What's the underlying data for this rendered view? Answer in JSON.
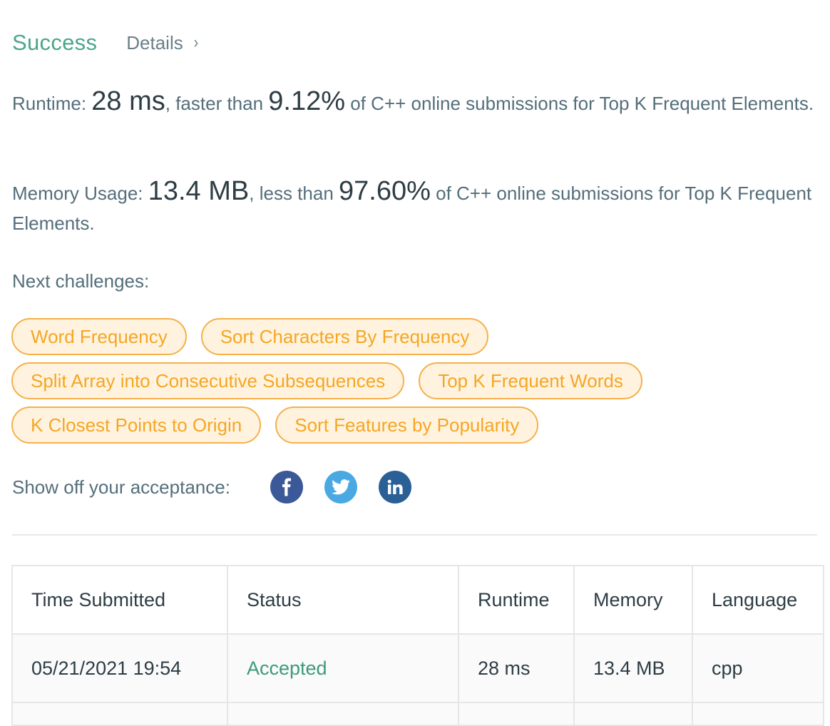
{
  "header": {
    "status": "Success",
    "details_label": "Details",
    "details_chevron": "›"
  },
  "runtime": {
    "label": "Runtime: ",
    "value": "28 ms",
    "comparator": ", faster than ",
    "percent": "9.12%",
    "suffix": " of C++ online submissions for Top K Frequent Elements."
  },
  "memory": {
    "label": "Memory Usage: ",
    "value": "13.4 MB",
    "comparator": ", less than ",
    "percent": "97.60%",
    "suffix": " of C++ online submissions for Top K Frequent Elements."
  },
  "next": {
    "label": "Next challenges:",
    "rows": [
      [
        "Word Frequency",
        "Sort Characters By Frequency"
      ],
      [
        "Split Array into Consecutive Subsequences",
        "Top K Frequent Words"
      ],
      [
        "K Closest Points to Origin",
        "Sort Features by Popularity"
      ]
    ]
  },
  "share": {
    "label": "Show off your acceptance:",
    "icons": [
      "facebook-icon",
      "twitter-icon",
      "linkedin-icon"
    ],
    "colors": {
      "facebook": "#3b5998",
      "twitter": "#4aa8e3",
      "linkedin": "#2a6095"
    }
  },
  "table": {
    "headers": [
      "Time Submitted",
      "Status",
      "Runtime",
      "Memory",
      "Language"
    ],
    "rows": [
      {
        "time": "05/21/2021 19:54",
        "status": "Accepted",
        "runtime": "28 ms",
        "memory": "13.4 MB",
        "language": "cpp"
      }
    ]
  },
  "colors": {
    "success": "#4ba58b",
    "tag_text": "#f5a623",
    "tag_border": "#f5b04a",
    "tag_bg": "#fff3e0",
    "accepted": "#3d9a7a"
  }
}
